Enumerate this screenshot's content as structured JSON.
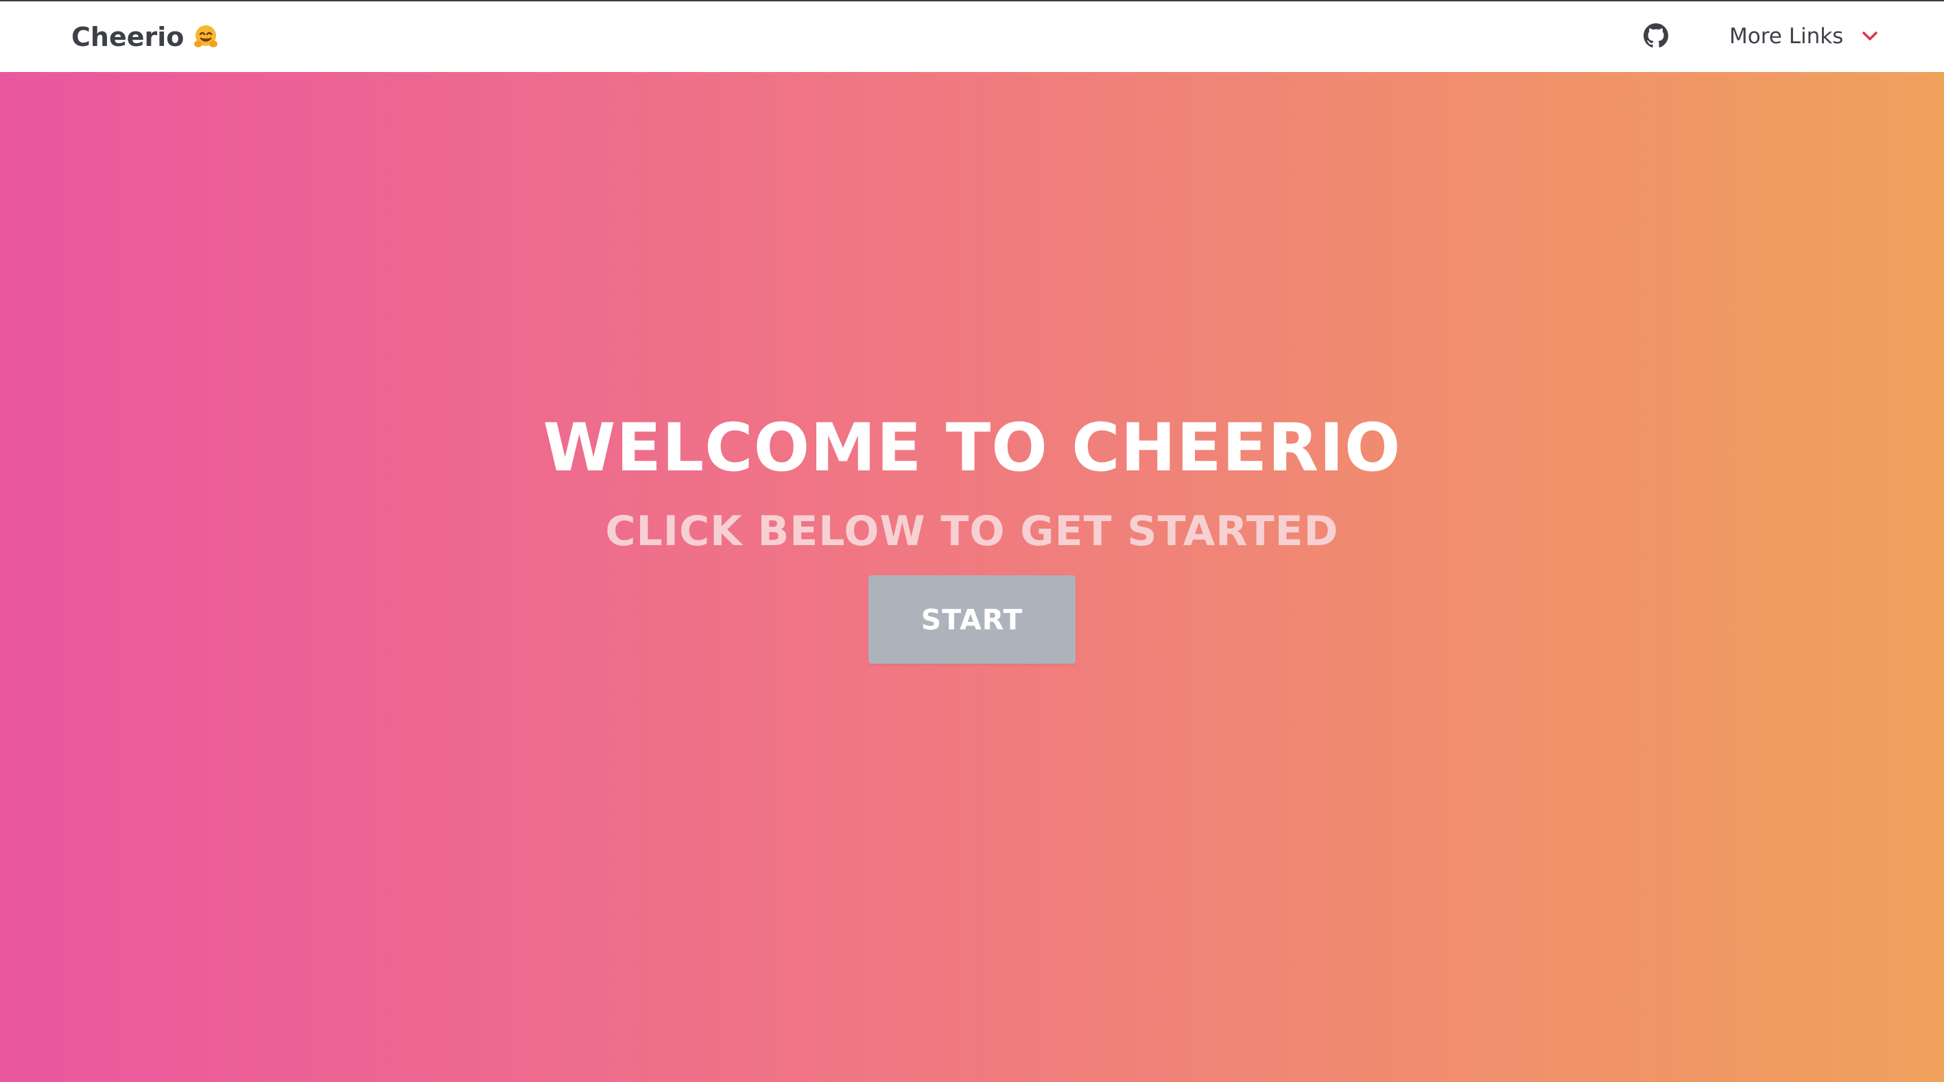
{
  "navbar": {
    "brand_text": "Cheerio",
    "brand_emoji": "hugging-face-emoji",
    "github_icon": "github-icon",
    "more_links_label": "More Links",
    "more_links_icon": "chevron-down-icon"
  },
  "hero": {
    "title": "WELCOME TO CHEERIO",
    "subtitle": "CLICK BELOW TO GET STARTED",
    "start_label": "START"
  },
  "colors": {
    "gradient_start": "#ea579f",
    "gradient_mid": "#f07783",
    "gradient_end": "#f0a15c",
    "button_bg": "#acb3bb",
    "chevron_accent": "#e2314f",
    "nav_text": "#3d4147"
  }
}
